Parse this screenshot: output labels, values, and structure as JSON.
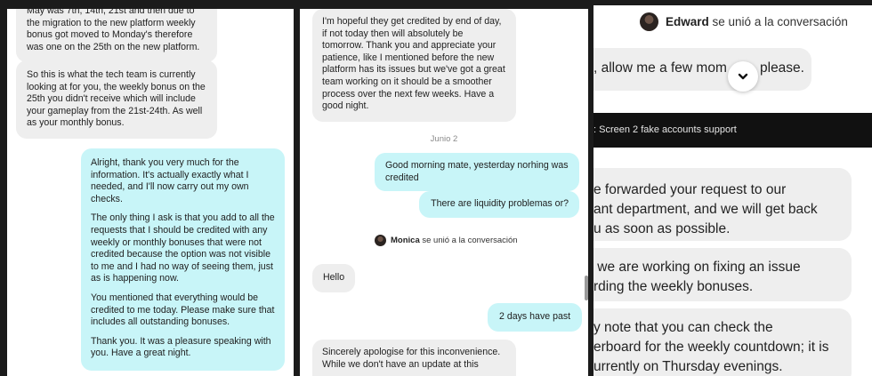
{
  "panel1": {
    "agent_msg1": "May was 7th, 14th, 21st and then due to the migration to the new platform weekly bonus got moved to Monday's therefore was one on the 25th on the new platform.",
    "agent_msg2": "So this is what the tech team is currently looking at for you, the weekly bonus on the 25th you didn't receive which will include your gameplay from the 21st-24th. As well as your monthly bonus.",
    "user_msg": [
      "Alright, thank you very much for the information. It's actually exactly what I needed, and I'll now carry out my own checks.",
      "The only thing I ask is that you add to all the requests that I should be credited with any weekly or monthly bonuses that were not credited because the option was not visible to me and I had no way of seeing them, just as is happening now.",
      "You mentioned that everything would be credited to me today. Please make sure that includes all outstanding bonuses.",
      "Thank you. It was a pleasure speaking with you. Have a great night."
    ]
  },
  "panel2": {
    "agent_msg1": "I'm hopeful they get credited by end of day, if not today then will absolutely be tomorrow. Thank you and appreciate your patience, like I mentioned before the new platform has its issues but we've got a great team working on it should be a smoother process over the next few weeks. Have a good night.",
    "date": "Junio 2",
    "user_msg1": "Good morning mate, yesterday norhing was credited",
    "user_msg2": "There are liquidity problemas or?",
    "joined_name": "Monica",
    "joined_text": "se unió a la conversación",
    "agent_hello": "Hello",
    "user_msg3": "2 days have past",
    "agent_msg2": "Sincerely apologise for this inconvenience. While we don't have an update at this"
  },
  "panel3": {
    "joined_name": "Edward",
    "joined_text": "se unió a la conversación",
    "line1": ", allow me a few mom",
    "line1_end": "please.",
    "bar_text": ": Screen 2 fake accounts support",
    "msg1": "e forwarded your request to our\nant department, and we will get back\nu as soon as possible.",
    "msg2": " we are working on fixing an issue\nrding the weekly bonuses.",
    "msg3": "y note that you can check the\nerboard for the weekly countdown; it is\nurrently on Thursday evenings.",
    "scroll_icon": "chevron-down-icon"
  }
}
